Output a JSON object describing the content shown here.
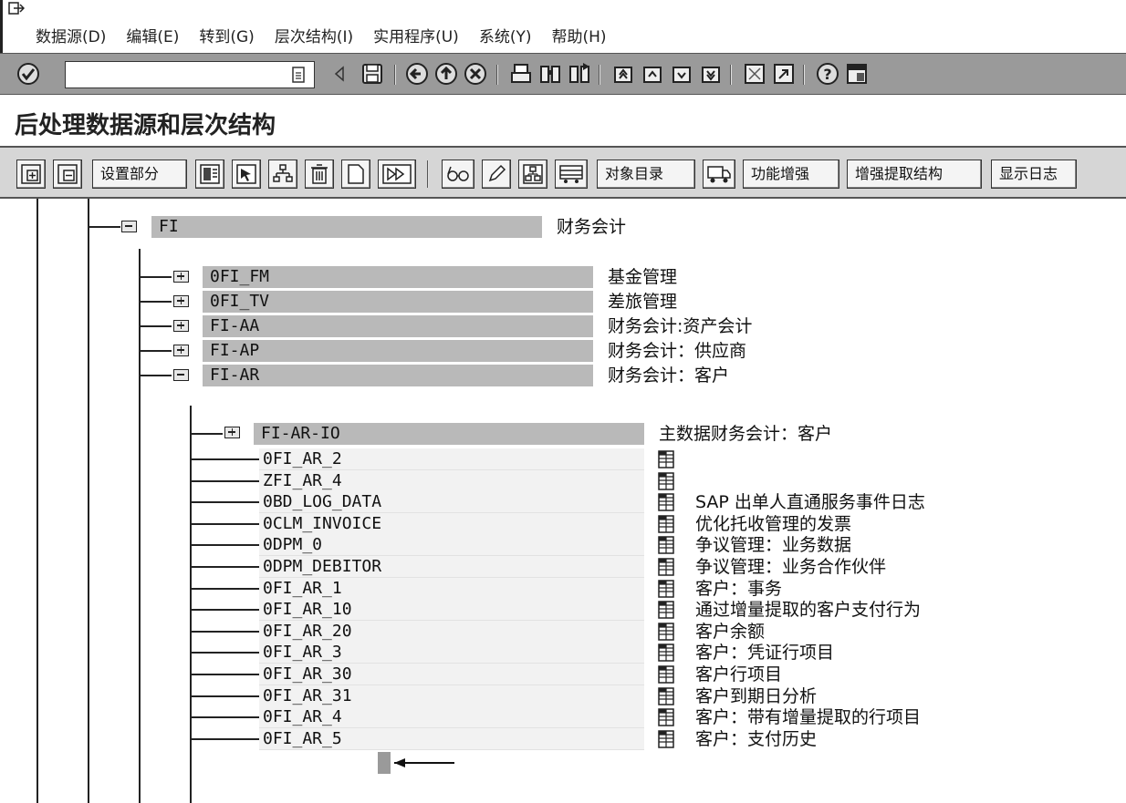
{
  "menu": {
    "items": [
      "数据源(D)",
      "编辑(E)",
      "转到(G)",
      "层次结构(I)",
      "实用程序(U)",
      "系统(Y)",
      "帮助(H)"
    ]
  },
  "toolbar": {
    "command_field_value": ""
  },
  "page_title": "后处理数据源和层次结构",
  "app_toolbar": {
    "buttons": [
      "设置部分",
      "对象目录",
      "功能增强",
      "增强提取结构",
      "显示日志"
    ]
  },
  "tree": {
    "root": {
      "code": "FI",
      "desc": "财务会计",
      "expanded": true
    },
    "level1": [
      {
        "code": "0FI_FM",
        "desc": "基金管理",
        "expanded": false
      },
      {
        "code": "0FI_TV",
        "desc": "差旅管理",
        "expanded": false
      },
      {
        "code": "FI-AA",
        "desc": "财务会计:资产会计",
        "expanded": false
      },
      {
        "code": "FI-AP",
        "desc": "财务会计：供应商",
        "expanded": false
      },
      {
        "code": "FI-AR",
        "desc": "财务会计：客户",
        "expanded": true
      }
    ],
    "sub_node": {
      "code": "FI-AR-IO",
      "desc": "主数据财务会计：客户",
      "expanded": false
    },
    "datasources": [
      {
        "code": "0FI_AR_2",
        "desc": ""
      },
      {
        "code": "ZFI_AR_4",
        "desc": ""
      },
      {
        "code": "0BD_LOG_DATA",
        "desc": "SAP 出单人直通服务事件日志"
      },
      {
        "code": "0CLM_INVOICE",
        "desc": "优化托收管理的发票"
      },
      {
        "code": "0DPM_0",
        "desc": "争议管理：业务数据"
      },
      {
        "code": "0DPM_DEBITOR",
        "desc": "争议管理：业务合作伙伴"
      },
      {
        "code": "0FI_AR_1",
        "desc": "客户：事务"
      },
      {
        "code": "0FI_AR_10",
        "desc": "通过增量提取的客户支付行为"
      },
      {
        "code": "0FI_AR_20",
        "desc": "客户余额"
      },
      {
        "code": "0FI_AR_3",
        "desc": "客户：凭证行项目"
      },
      {
        "code": "0FI_AR_30",
        "desc": "客户行项目"
      },
      {
        "code": "0FI_AR_31",
        "desc": "客户到期日分析"
      },
      {
        "code": "0FI_AR_4",
        "desc": "客户：带有增量提取的行项目"
      },
      {
        "code": "0FI_AR_5",
        "desc": "客户：支付历史"
      }
    ]
  }
}
